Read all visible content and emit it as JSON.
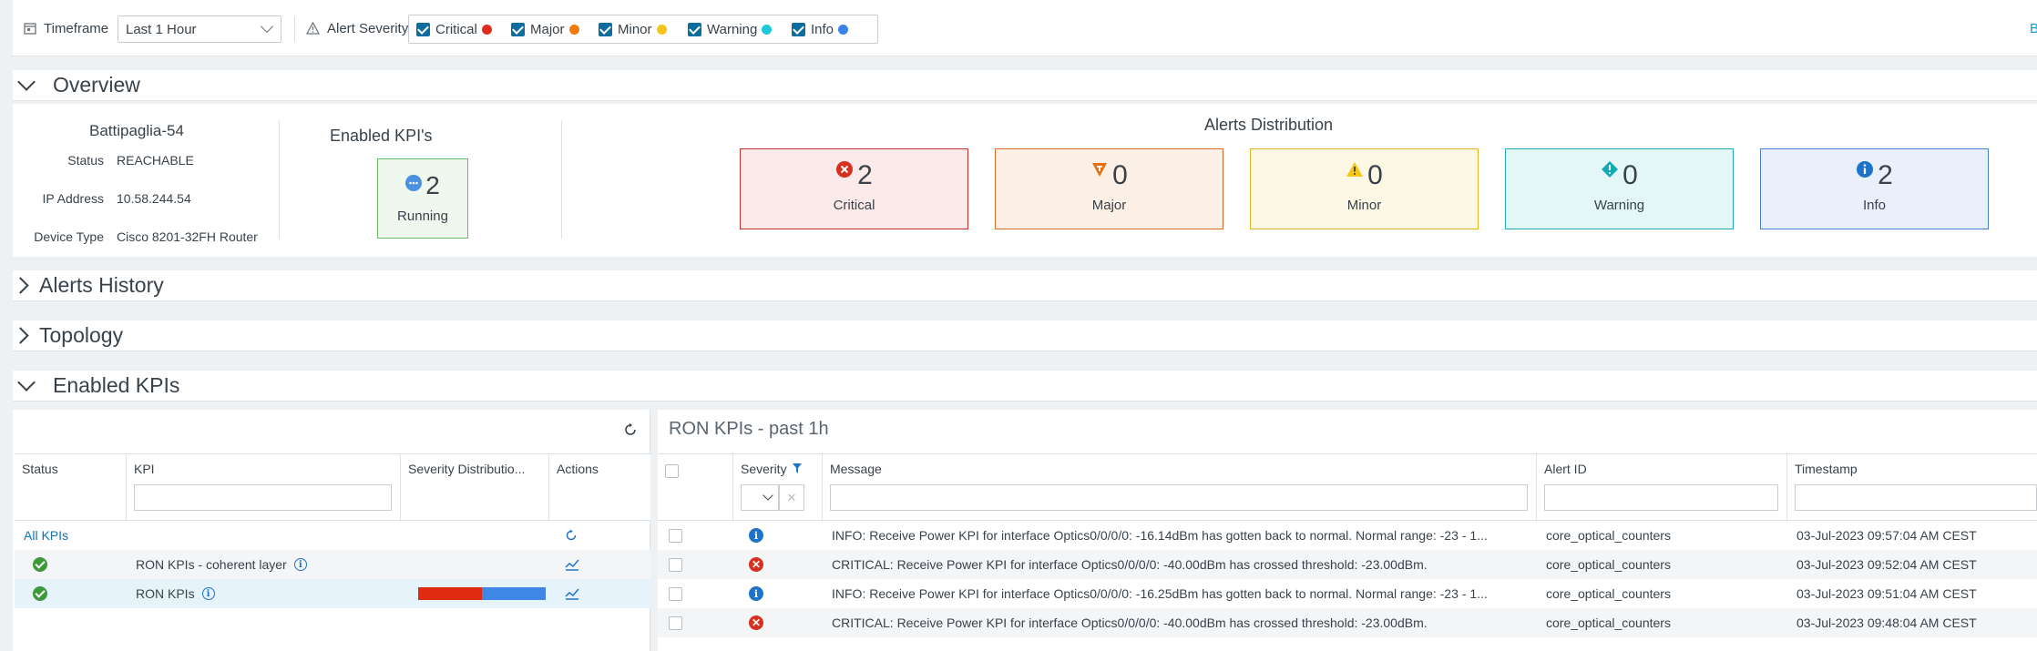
{
  "filterbar": {
    "timeframe_label": "Timeframe",
    "timeframe_value": "Last 1 Hour",
    "alert_severity_label": "Alert Severity",
    "severities": [
      {
        "label": "Critical",
        "color": "#e02d1b"
      },
      {
        "label": "Major",
        "color": "#f07a0a"
      },
      {
        "label": "Minor",
        "color": "#f5c518"
      },
      {
        "label": "Warning",
        "color": "#1ec9d6"
      },
      {
        "label": "Info",
        "color": "#3b82e6"
      }
    ],
    "back_link": "Bac"
  },
  "sections": {
    "overview": "Overview",
    "alerts_history": "Alerts History",
    "topology": "Topology",
    "enabled_kpis": "Enabled KPIs"
  },
  "device": {
    "name": "Battipaglia-54",
    "status_label": "Status",
    "status_value": "REACHABLE",
    "ip_label": "IP Address",
    "ip_value": "10.58.244.54",
    "type_label": "Device Type",
    "type_value": "Cisco 8201-32FH Router"
  },
  "enabled_kpis_card": {
    "title": "Enabled KPI's",
    "count": "2",
    "state": "Running"
  },
  "alerts_distribution": {
    "title": "Alerts Distribution",
    "cards": [
      {
        "label": "Critical",
        "count": "2",
        "icon": "critical-icon"
      },
      {
        "label": "Major",
        "count": "0",
        "icon": "major-icon"
      },
      {
        "label": "Minor",
        "count": "0",
        "icon": "minor-icon"
      },
      {
        "label": "Warning",
        "count": "0",
        "icon": "warning-icon"
      },
      {
        "label": "Info",
        "count": "2",
        "icon": "info-icon"
      }
    ]
  },
  "kpi_table": {
    "columns": {
      "status": "Status",
      "kpi": "KPI",
      "severity": "Severity Distributio...",
      "actions": "Actions"
    },
    "all_kpis": "All KPIs",
    "rows": [
      {
        "kpi": "RON KPIs - coherent layer",
        "status": "ok",
        "critical_fraction": 0,
        "info_fraction": 0
      },
      {
        "kpi": "RON KPIs",
        "status": "ok",
        "critical_fraction": 0.5,
        "info_fraction": 0.5
      }
    ]
  },
  "alerts_table": {
    "title": "RON KPIs - past 1h",
    "columns": {
      "severity": "Severity",
      "message": "Message",
      "alert_id": "Alert ID",
      "timestamp": "Timestamp"
    },
    "rows": [
      {
        "severity": "info",
        "message": "INFO: Receive Power KPI for interface Optics0/0/0/0: -16.14dBm has gotten back to normal. Normal range: -23 - 1...",
        "alert_id": "core_optical_counters",
        "timestamp": "03-Jul-2023 09:57:04 AM CEST"
      },
      {
        "severity": "critical",
        "message": "CRITICAL: Receive Power KPI for interface Optics0/0/0/0: -40.00dBm has crossed threshold: -23.00dBm.",
        "alert_id": "core_optical_counters",
        "timestamp": "03-Jul-2023 09:52:04 AM CEST"
      },
      {
        "severity": "info",
        "message": "INFO: Receive Power KPI for interface Optics0/0/0/0: -16.25dBm has gotten back to normal. Normal range: -23 - 1...",
        "alert_id": "core_optical_counters",
        "timestamp": "03-Jul-2023 09:51:04 AM CEST"
      },
      {
        "severity": "critical",
        "message": "CRITICAL: Receive Power KPI for interface Optics0/0/0/0: -40.00dBm has crossed threshold: -23.00dBm.",
        "alert_id": "core_optical_counters",
        "timestamp": "03-Jul-2023 09:48:04 AM CEST"
      }
    ]
  }
}
